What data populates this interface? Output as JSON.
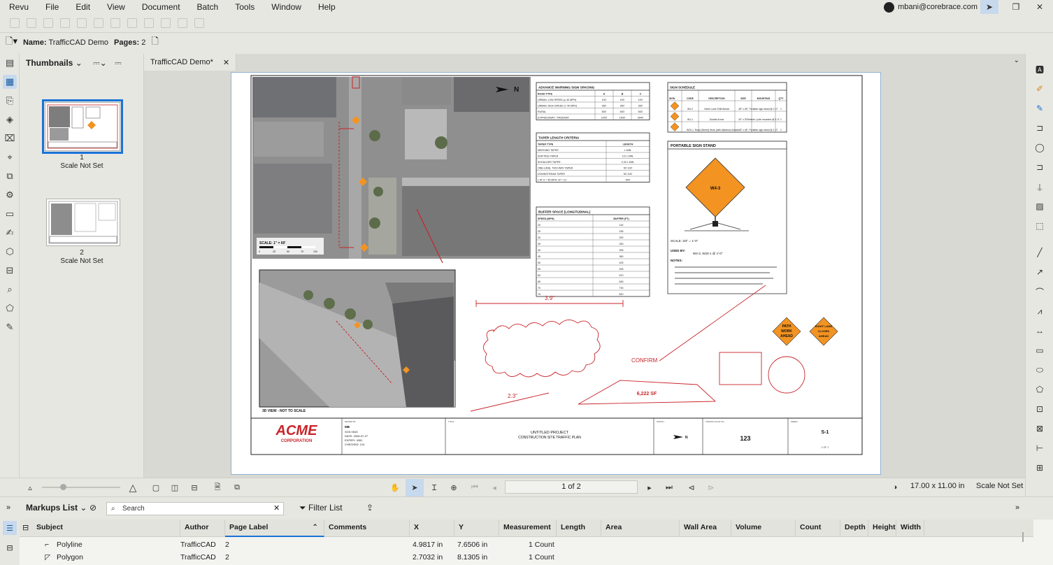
{
  "menubar": {
    "items": [
      "Revu",
      "File",
      "Edit",
      "View",
      "Document",
      "Batch",
      "Tools",
      "Window",
      "Help"
    ],
    "user_email": "mbani@corebrace.com"
  },
  "propbar": {
    "name_label": "Name:",
    "name_value": "TrafficCAD Demo",
    "pages_label": "Pages:",
    "pages_value": "2"
  },
  "thumbnails": {
    "title": "Thumbnails",
    "items": [
      {
        "number": "1",
        "scale": "Scale Not Set"
      },
      {
        "number": "2",
        "scale": "Scale Not Set"
      }
    ]
  },
  "document": {
    "tab_title": "TrafficCAD Demo*",
    "sheet": {
      "tables": {
        "advance_warning": {
          "title": "ADVANCE WARNING SIGN SPACING",
          "headers": [
            "ROAD TYPE",
            "A",
            "B",
            "C"
          ],
          "rows": [
            [
              "URBAN, LOW SPEED (≤ 40 MPH)",
              "100'",
              "100'",
              "100'"
            ],
            [
              "URBAN, HIGH SPEED (> 40 MPH)",
              "350'",
              "350'",
              "350'"
            ],
            [
              "RURAL",
              "500'",
              "500'",
              "500'"
            ],
            [
              "EXPRESSWAY / FREEWAY",
              "1000'",
              "1500'",
              "2640'"
            ]
          ]
        },
        "taper_length": {
          "title": "TAPER LENGTH CRITERIA",
          "headers": [
            "TAPER TYPE",
            "LENGTH"
          ],
          "rows": [
            [
              "MERGING TAPER",
              "L MIN."
            ],
            [
              "SHIFTING TAPER",
              "0.5 L MIN."
            ],
            [
              "SHOULDER TAPER",
              "0.33 L MIN."
            ],
            [
              "ONE-LANE, TWO-WAY TAPER",
              "50'-100'"
            ],
            [
              "DOWNSTREAM TAPER",
              "50'-100'"
            ],
            [
              "L AT S = 45 MPH, W = 12'",
              "540'"
            ]
          ]
        },
        "buffer_space": {
          "title": "BUFFER SPACE (LONGITUDINAL)",
          "headers": [
            "SPEED (MPH)",
            "BUFFER (FT)"
          ],
          "rows": [
            [
              "20",
              "115"
            ],
            [
              "25",
              "155"
            ],
            [
              "30",
              "200"
            ],
            [
              "35",
              "250"
            ],
            [
              "40",
              "305"
            ],
            [
              "45",
              "360"
            ],
            [
              "50",
              "425"
            ],
            [
              "55",
              "495"
            ],
            [
              "60",
              "570"
            ],
            [
              "65",
              "645"
            ],
            [
              "70",
              "730"
            ],
            [
              "75",
              "820"
            ]
          ]
        },
        "sign_schedule": {
          "title": "SIGN SCHEDULE",
          "headers": [
            "SIGN",
            "CODE",
            "DESCRIPTION",
            "SIZE",
            "MOUNTING",
            "QTY"
          ],
          "rows": [
            [
              "",
              "W4-2",
              "Home Lane Shift Ahead",
              "48\" x 48\"",
              "Portable sign stand @ 1'-0\"",
              "1"
            ],
            [
              "",
              "W1-1",
              "Double Arrow",
              "30\" x 30\"",
              "Vehicle / pole mounted @ 5'-0\"",
              "1"
            ],
            [
              "",
              "W20-1",
              "Road (Street) Work (with distance) Ahead",
              "48\" x 48\"",
              "Portable sign stand @ 1'-0\"",
              "1"
            ]
          ]
        }
      },
      "portable_sign_stand": {
        "title": "PORTABLE SIGN STAND",
        "sign_code": "W4-3",
        "scale": "SCALE: 3/4\" = 1'-0\"",
        "used_by_label": "USED BY:",
        "used_by_value": "W4-3, W20-1 @ 1'-0\"",
        "notes_label": "NOTES:"
      },
      "map": {
        "north": "N",
        "scale_label": "SCALE: 1\" = 60'",
        "scale_ticks": [
          "0",
          "25",
          "50",
          "75",
          "100"
        ]
      },
      "view3d_caption": "3D VIEW - NOT TO SCALE",
      "markups": {
        "dim_top": "3.9\"",
        "dim_bottom": "2.3\"",
        "area_label": "6,222 SF",
        "callout": "CONFIRM"
      },
      "orange_signs": [
        {
          "lines": [
            "PATH",
            "WORK",
            "AHEAD"
          ]
        },
        {
          "lines": [
            "RIGHT LANE",
            "CLOSED",
            "AHEAD"
          ]
        }
      ],
      "title_block": {
        "company_top": "ACME",
        "company_bottom": "CORPORATION",
        "drawn_by_label": "DRAWN BY",
        "drawn_by_lines": [
          "MB",
          "SCN 0543",
          "DATE: 2026-07-27",
          "EXPIRY: 4281",
          "CHECKED: 214"
        ],
        "title_label": "TITLE",
        "title_line1": "UNTITLED PROJECT",
        "title_line2": "CONSTRUCTION SITE TRAFFIC PLAN",
        "north_label": "NORTH",
        "plan_label": "TRAFFIC PLAN NO.",
        "plan_number": "123",
        "sheet_label": "SHEET",
        "sheet_number": "S-1",
        "sheet_of": "1 OF 1"
      }
    }
  },
  "navbar": {
    "page_indicator": "1 of 2",
    "page_size": "17.00 x 11.00 in",
    "scale": "Scale Not Set"
  },
  "markups_list": {
    "title": "Markups List",
    "search_placeholder": "Search",
    "filter_label": "Filter List",
    "columns": [
      "Subject",
      "Author",
      "Page Label",
      "Comments",
      "X",
      "Y",
      "Measurement",
      "Length",
      "Area",
      "Wall Area",
      "Volume",
      "Count",
      "Depth",
      "Height",
      "Width"
    ],
    "rows": [
      {
        "subject": "Polyline",
        "author": "TrafficCAD",
        "page": "2",
        "comments": "",
        "x": "4.9817 in",
        "y": "7.6506 in",
        "measurement": "1 Count"
      },
      {
        "subject": "Polygon",
        "author": "TrafficCAD",
        "page": "2",
        "comments": "",
        "x": "2.7032 in",
        "y": "8.1305 in",
        "measurement": "1 Count"
      }
    ]
  },
  "colors": {
    "accent": "#1a73d6",
    "markup_red": "#c8252a",
    "sign_orange": "#f39322",
    "selection": "#c7d9ec"
  }
}
